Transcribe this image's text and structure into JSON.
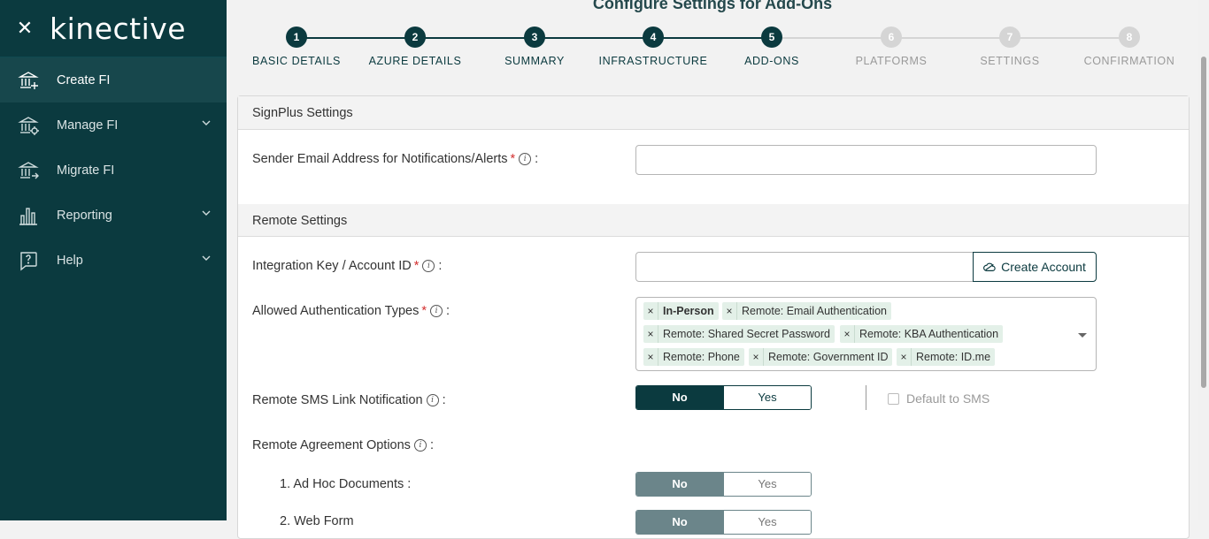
{
  "brand": {
    "logo": "kinective"
  },
  "sidebar": {
    "items": [
      {
        "label": "Create FI",
        "icon": "bank-add-icon",
        "active": true
      },
      {
        "label": "Manage FI",
        "icon": "bank-gear-icon",
        "expandable": true
      },
      {
        "label": "Migrate FI",
        "icon": "bank-arrow-icon"
      },
      {
        "label": "Reporting",
        "icon": "bar-chart-icon",
        "expandable": true
      },
      {
        "label": "Help",
        "icon": "help-icon",
        "expandable": true
      }
    ]
  },
  "page": {
    "title": "Configure Settings for Add-Ons"
  },
  "stepper": {
    "steps": [
      {
        "number": "1",
        "label": "BASIC DETAILS",
        "done": true
      },
      {
        "number": "2",
        "label": "AZURE DETAILS",
        "done": true
      },
      {
        "number": "3",
        "label": "SUMMARY",
        "done": true
      },
      {
        "number": "4",
        "label": "INFRASTRUCTURE",
        "done": true
      },
      {
        "number": "5",
        "label": "ADD-ONS",
        "done": true
      },
      {
        "number": "6",
        "label": "PLATFORMS",
        "done": false
      },
      {
        "number": "7",
        "label": "SETTINGS",
        "done": false
      },
      {
        "number": "8",
        "label": "CONFIRMATION",
        "done": false
      }
    ]
  },
  "signplus": {
    "heading": "SignPlus Settings",
    "sender_email_label": "Sender Email Address for Notifications/Alerts",
    "sender_email_value": ""
  },
  "remote": {
    "heading": "Remote Settings",
    "integration_key_label": "Integration Key / Account ID",
    "integration_key_value": "",
    "create_account_label": "Create Account",
    "auth_types_label": "Allowed Authentication Types",
    "auth_types": [
      "In-Person",
      "Remote: Email Authentication",
      "Remote: Shared Secret Password",
      "Remote: KBA Authentication",
      "Remote: Phone",
      "Remote: Government ID",
      "Remote: ID.me"
    ],
    "sms_label": "Remote SMS Link Notification",
    "sms_selected": "No",
    "default_sms_label": "Default to SMS",
    "agreement_label": "Remote Agreement Options",
    "adhoc_label": "1. Ad Hoc Documents :",
    "webform_label": "2. Web Form",
    "no_label": "No",
    "yes_label": "Yes",
    "required_mark": "*",
    "colon": ":"
  },
  "colors": {
    "primary": "#0b3a3f",
    "tag_bg": "#e3f0e8",
    "required": "#d32f2f"
  }
}
